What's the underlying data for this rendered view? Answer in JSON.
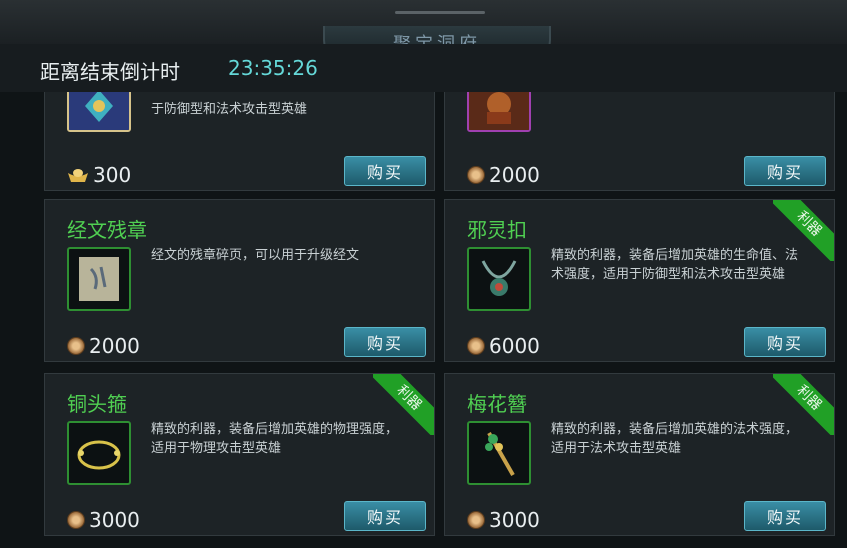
{
  "header": {
    "title": "聚宝洞府"
  },
  "countdown": {
    "label": "距离结束倒计时",
    "time": "23:35:26"
  },
  "buy_label": "购买",
  "cards": [
    {
      "desc": "于防御型和法术攻击型英雄",
      "currency": "ingot",
      "price": "300"
    },
    {
      "desc": "",
      "currency": "coin",
      "price": "2000"
    },
    {
      "name": "经文残章",
      "desc": "经文的残章碎页，可以用于升级经文",
      "currency": "coin",
      "price": "2000",
      "badge": "",
      "icon": "scroll-icon"
    },
    {
      "name": "邪灵扣",
      "desc": "精致的利器，装备后增加英雄的生命值、法术强度，适用于防御型和法术攻击型英雄",
      "currency": "coin",
      "price": "6000",
      "badge": "利器",
      "icon": "amulet-icon"
    },
    {
      "name": "铜头箍",
      "desc": "精致的利器，装备后增加英雄的物理强度，适用于物理攻击型英雄",
      "currency": "coin",
      "price": "3000",
      "badge": "利器",
      "icon": "circlet-icon"
    },
    {
      "name": "梅花簪",
      "desc": "精致的利器，装备后增加英雄的法术强度，适用于法术攻击型英雄",
      "currency": "coin",
      "price": "3000",
      "badge": "利器",
      "icon": "hairpin-icon"
    }
  ]
}
